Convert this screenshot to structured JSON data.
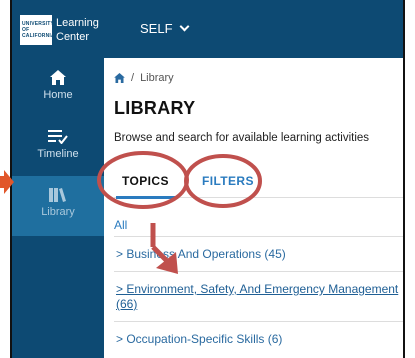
{
  "header": {
    "logo_lines": [
      "UNIVERSITY",
      "OF",
      "CALIFORNIA"
    ],
    "app_name_line1": "Learning",
    "app_name_line2": "Center",
    "menu_label": "SELF"
  },
  "sidebar": {
    "items": [
      {
        "label": "Home",
        "icon": "home-icon"
      },
      {
        "label": "Timeline",
        "icon": "timeline-icon"
      },
      {
        "label": "Library",
        "icon": "library-icon"
      }
    ]
  },
  "breadcrumb": {
    "current": "Library"
  },
  "page": {
    "title": "LIBRARY",
    "subtitle": "Browse and search for available learning activities"
  },
  "tabs": [
    {
      "label": "TOPICS"
    },
    {
      "label": "FILTERS"
    }
  ],
  "topics": {
    "all_label": "All",
    "items": [
      "> Business And Operations (45)",
      "> Environment, Safety, And Emergency Management (66)",
      "> Occupation-Specific Skills (6)"
    ]
  },
  "annotation_colors": {
    "circle": "#c0504d",
    "arrow": "#e1572a"
  }
}
